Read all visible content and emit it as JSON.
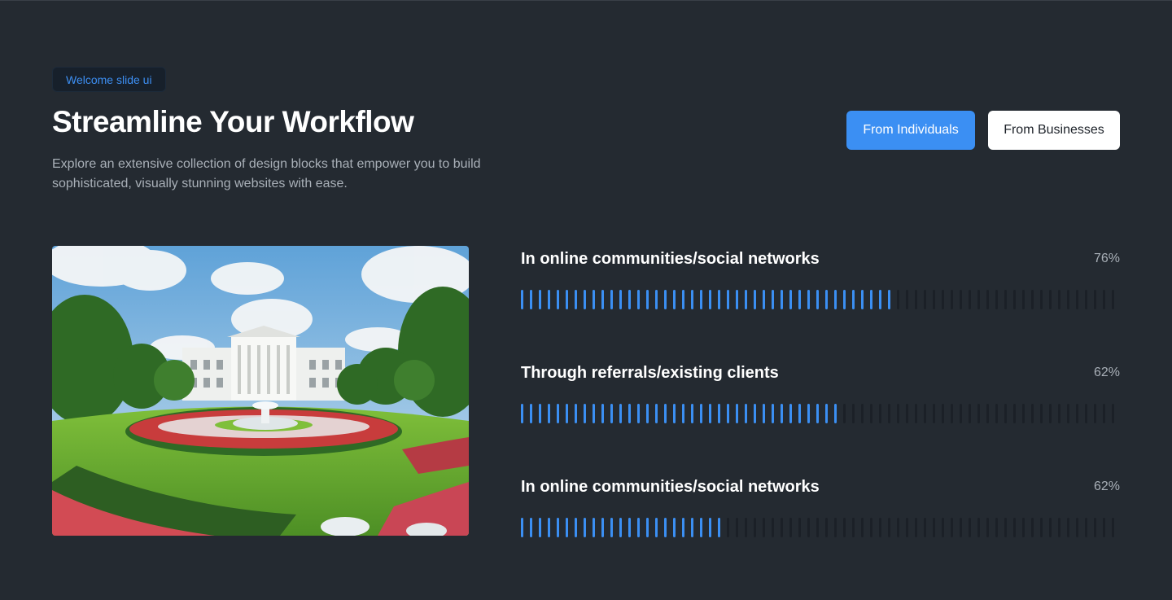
{
  "badge": "Welcome slide ui",
  "title": "Streamline Your Workflow",
  "subtitle": "Explore an extensive collection of design blocks that empower you to build sophisticated, visually stunning websites with ease.",
  "buttons": {
    "individuals": "From Individuals",
    "businesses": "From Businesses"
  },
  "colors": {
    "accent": "#3b8ff3",
    "track": "#1b2027",
    "background": "#242a31"
  },
  "stats": [
    {
      "label": "In online communities/social networks",
      "value_text": "76%",
      "fill": 0.62
    },
    {
      "label": "Through referrals/existing clients",
      "value_text": "62%",
      "fill": 0.53
    },
    {
      "label": "In online communities/social networks",
      "value_text": "62%",
      "fill": 0.35
    }
  ]
}
